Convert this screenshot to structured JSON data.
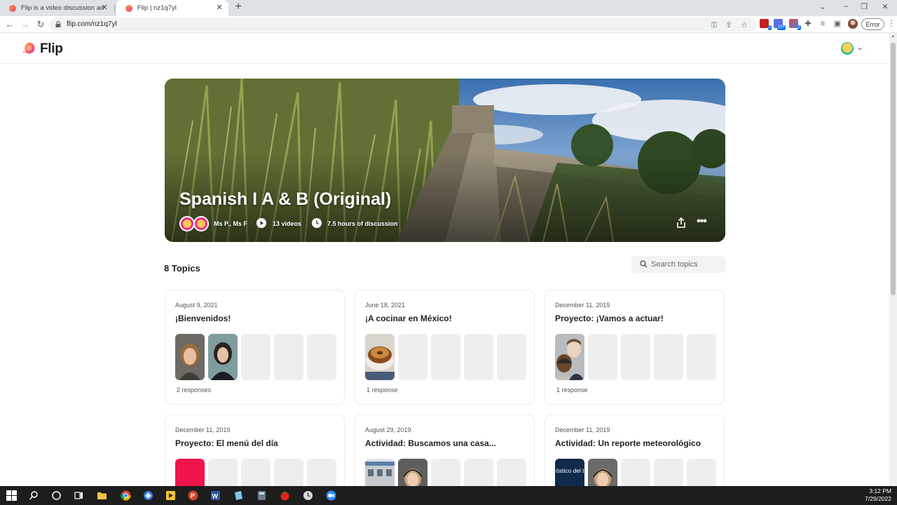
{
  "browser": {
    "tabs": [
      {
        "title": "Flip is a video discussion and sha",
        "active": false
      },
      {
        "title": "Flip | nz1q7yl",
        "active": true
      }
    ],
    "url": "flip.com/nz1q7yl",
    "profile_status": "Error",
    "extension_badges": [
      "2",
      "10+",
      "2"
    ]
  },
  "app": {
    "logo": "Flip"
  },
  "group": {
    "title": "Spanish I A & B (Original)",
    "owners": "Ms P., Ms F",
    "videos": "13 videos",
    "discussion": "7.5 hours of discussion"
  },
  "topics": {
    "count_label": "8 Topics",
    "search_placeholder": "Search topics",
    "items": [
      {
        "date": "August 9, 2021",
        "title": "¡Bienvenidos!",
        "responses": "2 responses"
      },
      {
        "date": "June 18, 2021",
        "title": "¡A cocinar en México!",
        "responses": "1 response"
      },
      {
        "date": "December 11, 2019",
        "title": "Proyecto: ¡Vamos a actuar!",
        "responses": "1 response"
      },
      {
        "date": "December 11, 2019",
        "title": "Proyecto: El menú del día",
        "responses": ""
      },
      {
        "date": "August 29, 2019",
        "title": "Actividad: Buscamos una casa...",
        "responses": ""
      },
      {
        "date": "December 11, 2019",
        "title": "Actividad: Un reporte meteorológico",
        "responses": ""
      }
    ]
  },
  "thumb_text": {
    "weather": "óstico del ti"
  },
  "taskbar": {
    "time": "3:12 PM",
    "date": "7/29/2022"
  },
  "colors": {
    "flip_pink": "#ec2d8b",
    "flip_orange": "#f6a23a",
    "placeholder_tile": "#eeeeee",
    "taskbar": "#1d1d1d"
  }
}
